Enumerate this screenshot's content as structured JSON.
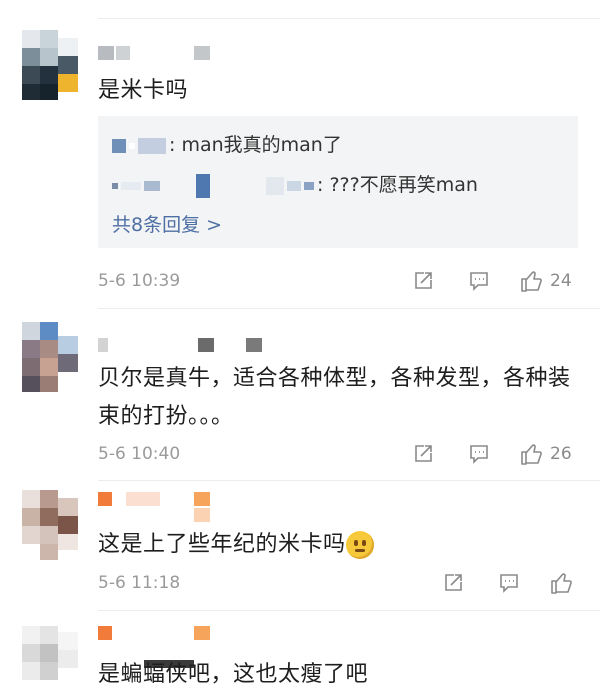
{
  "comments": [
    {
      "text": "是米卡吗",
      "replies": [
        {
          "suffix": ": man我真的man了"
        },
        {
          "suffix": ": ???不愿再笑man"
        }
      ],
      "more_replies": "共8条回复 >",
      "time": "5-6 10:39",
      "like_count": "24"
    },
    {
      "text": "贝尔是真牛，适合各种体型，各种发型，各种装束的打扮。。。",
      "time": "5-6 10:40",
      "like_count": "26"
    },
    {
      "text": "这是上了些年纪的米卡吗",
      "time": "5-6 11:18",
      "like_count": ""
    },
    {
      "text": "是蝙蝠侠吧，这也太瘦了吧"
    }
  ],
  "colors": {
    "link": "#4e6fa3",
    "meta": "#9a9a9a",
    "reply_bg": "#f3f4f6"
  },
  "icons": [
    "share-icon",
    "comment-icon",
    "like-icon"
  ]
}
